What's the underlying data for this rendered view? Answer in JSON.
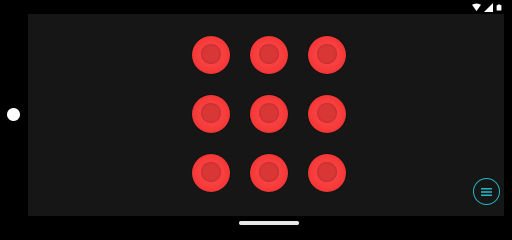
{
  "status_bar": {
    "icons": [
      "wifi-icon",
      "signal-icon",
      "battery-icon"
    ]
  },
  "grid": {
    "rows": 3,
    "columns": 3,
    "buttons": [
      "red-circle",
      "red-circle",
      "red-circle",
      "red-circle",
      "red-circle",
      "red-circle",
      "red-circle",
      "red-circle",
      "red-circle"
    ]
  },
  "fab": {
    "icon": "menu-icon"
  },
  "colors": {
    "screen_background": "#161616",
    "button_red": "#f63a3a",
    "fab_accent": "#22b8c8"
  }
}
